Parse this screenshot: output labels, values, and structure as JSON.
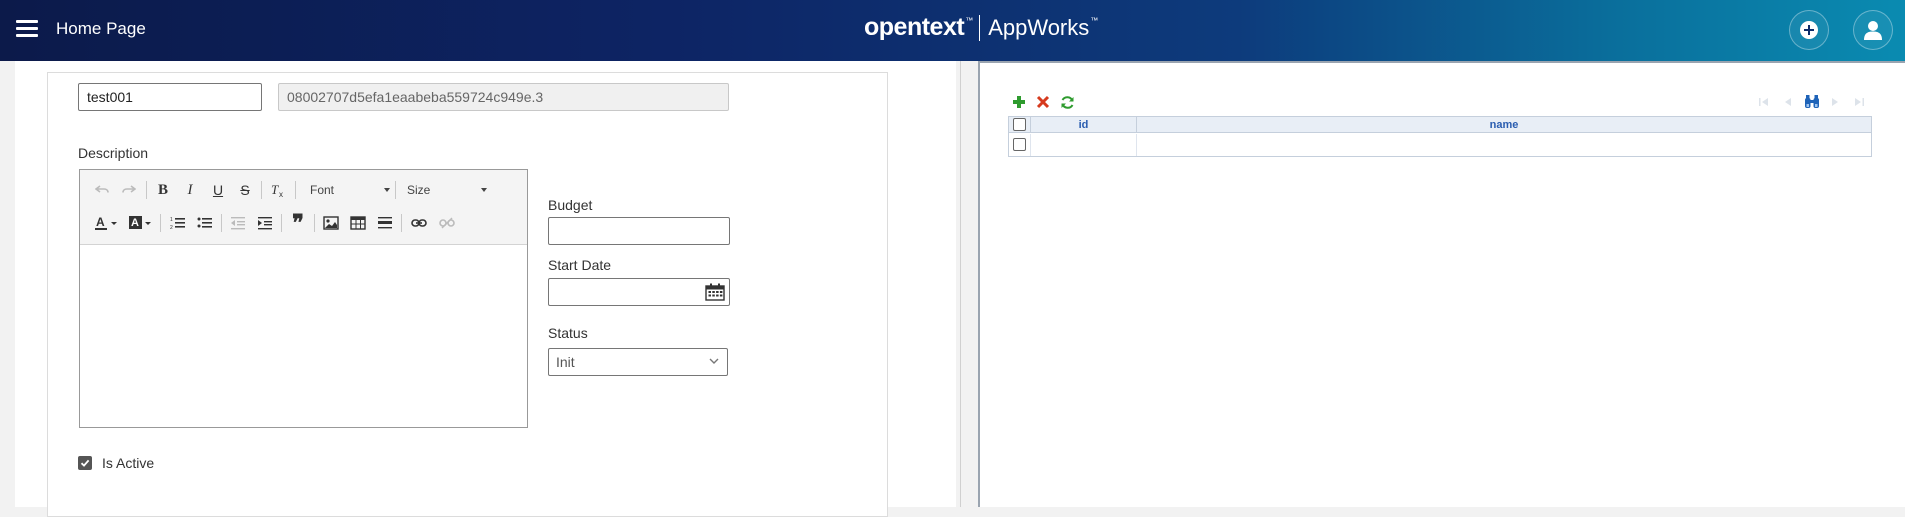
{
  "header": {
    "title": "Home Page",
    "brand_logo": "opentext",
    "brand_tm": "™",
    "brand_product": "AppWorks",
    "product_tm": "™",
    "icons": {
      "menu": "hamburger-menu-icon",
      "add": "plus-circle-icon",
      "user": "user-icon"
    }
  },
  "form": {
    "name_value": "test001",
    "id_value": "08002707d5efa1eaabeba559724c949e.3",
    "description_label": "Description",
    "editor": {
      "font_label": "Font",
      "size_label": "Size",
      "bold": "B",
      "italic": "I",
      "underline": "U",
      "strike": "S",
      "quote": "❞"
    },
    "budget_label": "Budget",
    "budget_value": "",
    "start_date_label": "Start Date",
    "start_date_value": "",
    "status_label": "Status",
    "status_value": "Init",
    "is_active_label": "Is Active",
    "is_active_checked": true
  },
  "grid": {
    "columns": [
      "id",
      "name"
    ],
    "rows": [
      {
        "id": "",
        "name": ""
      }
    ],
    "colors": {
      "add": "#2e9b2e",
      "delete": "#d63a1e",
      "refresh": "#2e9b2e",
      "header_text": "#2a5db0"
    }
  },
  "colors": {
    "header_start": "#0c1a4a",
    "header_end": "#0a8bb1"
  }
}
